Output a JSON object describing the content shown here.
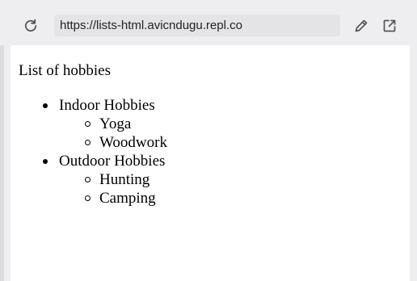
{
  "browser": {
    "url": "https://lists-html.avicndugu.repl.co"
  },
  "page": {
    "intro": "List of hobbies",
    "categories": [
      {
        "label": "Indoor Hobbies",
        "items": [
          "Yoga",
          "Woodwork"
        ]
      },
      {
        "label": "Outdoor Hobbies",
        "items": [
          "Hunting",
          "Camping"
        ]
      }
    ]
  }
}
